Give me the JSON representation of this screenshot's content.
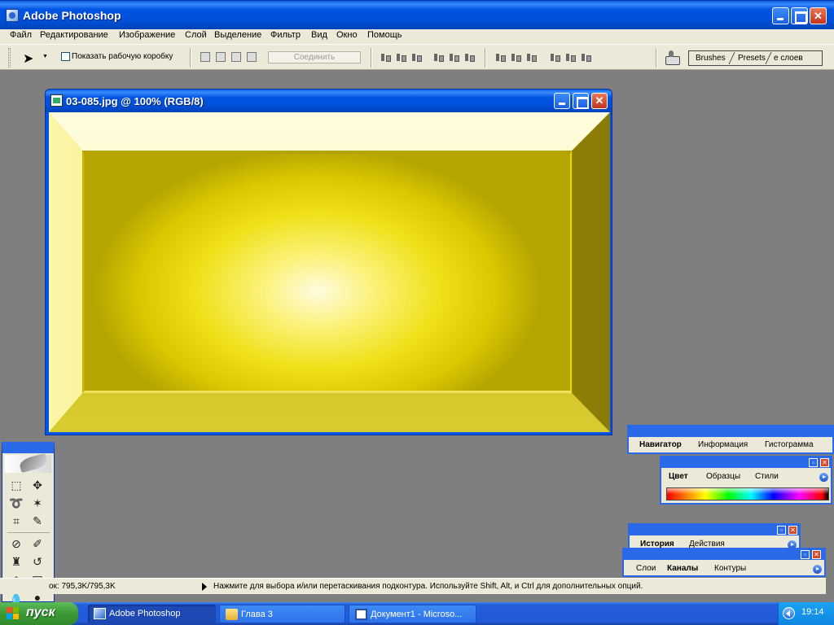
{
  "app": {
    "title": "Adobe Photoshop"
  },
  "menu": [
    "Файл",
    "Редактирование",
    "Изображение",
    "Слой",
    "Выделение",
    "Фильтр",
    "Вид",
    "Окно",
    "Помощь"
  ],
  "options_bar": {
    "show_bounding_box_label": "Показать рабочую коробку",
    "show_bounding_box_checked": false,
    "combine_button": "Соединить",
    "palette_well_tabs": [
      "Brushes",
      "Presets",
      "е слоев"
    ]
  },
  "document": {
    "title": "03-085.jpg @ 100% (RGB/8)"
  },
  "palettes": {
    "navigator": {
      "tabs": [
        "Навигатор",
        "Информация",
        "Гистограмма"
      ],
      "active": "Навигатор"
    },
    "color": {
      "tabs": [
        "Цвет",
        "Образцы",
        "Стили"
      ],
      "active": "Цвет"
    },
    "history": {
      "tabs": [
        "История",
        "Действия"
      ],
      "active": "История"
    },
    "layers": {
      "tabs": [
        "Слои",
        "Каналы",
        "Контуры"
      ],
      "active": "Каналы"
    }
  },
  "status_bar": {
    "doc_size": "ок: 795,3K/795,3K",
    "message": "Нажмите для выбора и/или перетаскивания подконтура. Используйте Shift, Alt, и Ctrl для дополнительных опций."
  },
  "taskbar": {
    "start_label": "пуск",
    "tasks": [
      {
        "label": "Adobe Photoshop",
        "active": true,
        "icon": "photoshop-icon"
      },
      {
        "label": "Глава 3",
        "active": false,
        "icon": "folder-icon"
      },
      {
        "label": "Документ1 - Microso...",
        "active": false,
        "icon": "word-icon"
      }
    ],
    "clock": "19:14"
  },
  "colors": {
    "xp_blue": "#0054e3",
    "canvas_yellow": "#f0e018",
    "workspace_gray": "#7f7f7f",
    "start_green": "#3c9a36"
  }
}
